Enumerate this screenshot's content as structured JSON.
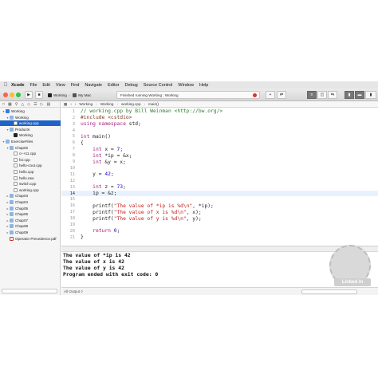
{
  "menubar": {
    "apple": "",
    "items": [
      "Xcode",
      "File",
      "Edit",
      "View",
      "Find",
      "Navigate",
      "Editor",
      "Debug",
      "Source Control",
      "Window",
      "Help"
    ]
  },
  "toolbar": {
    "scheme": "Working",
    "destination": "My Mac",
    "status": "Finished running Working : Working"
  },
  "navigator": {
    "rows": [
      {
        "label": "Working",
        "indent": 0,
        "icon": "proj",
        "tri": "▾",
        "selected": false
      },
      {
        "label": "Working",
        "indent": 1,
        "icon": "folder",
        "tri": "▾",
        "selected": false
      },
      {
        "label": "working.cpp",
        "indent": 2,
        "icon": "file",
        "tri": "",
        "selected": true
      },
      {
        "label": "Products",
        "indent": 1,
        "icon": "folder",
        "tri": "▾",
        "selected": false
      },
      {
        "label": "Working",
        "indent": 2,
        "icon": "target",
        "tri": "",
        "selected": false
      },
      {
        "label": "ExerciseFiles",
        "indent": 0,
        "icon": "folder",
        "tri": "▾",
        "selected": false
      },
      {
        "label": "Chap02",
        "indent": 1,
        "icon": "folder",
        "tri": "▾",
        "selected": false
      },
      {
        "label": "c++11.cpp",
        "indent": 2,
        "icon": "file",
        "tri": "",
        "selected": false
      },
      {
        "label": "for.cpp",
        "indent": 2,
        "icon": "file",
        "tri": "",
        "selected": false
      },
      {
        "label": "hello-cout.cpp",
        "indent": 2,
        "icon": "file",
        "tri": "",
        "selected": false
      },
      {
        "label": "hello.cpp",
        "indent": 2,
        "icon": "file",
        "tri": "",
        "selected": false
      },
      {
        "label": "hello.raw",
        "indent": 2,
        "icon": "file",
        "tri": "",
        "selected": false
      },
      {
        "label": "switch.cpp",
        "indent": 2,
        "icon": "file",
        "tri": "",
        "selected": false
      },
      {
        "label": "working.cpp",
        "indent": 2,
        "icon": "file",
        "tri": "",
        "selected": false
      },
      {
        "label": "Chap03",
        "indent": 1,
        "icon": "folder",
        "tri": "▸",
        "selected": false
      },
      {
        "label": "Chap04",
        "indent": 1,
        "icon": "folder",
        "tri": "▸",
        "selected": false
      },
      {
        "label": "Chap05",
        "indent": 1,
        "icon": "folder",
        "tri": "▸",
        "selected": false
      },
      {
        "label": "Chap06",
        "indent": 1,
        "icon": "folder",
        "tri": "▸",
        "selected": false
      },
      {
        "label": "Chap07",
        "indent": 1,
        "icon": "folder",
        "tri": "▸",
        "selected": false
      },
      {
        "label": "Chap08",
        "indent": 1,
        "icon": "folder",
        "tri": "▸",
        "selected": false
      },
      {
        "label": "Chap09",
        "indent": 1,
        "icon": "folder",
        "tri": "▸",
        "selected": false
      },
      {
        "label": "Operator Precedence.pdf",
        "indent": 1,
        "icon": "pdf",
        "tri": "",
        "selected": false
      }
    ]
  },
  "jumpbar": {
    "crumbs": [
      "Working",
      "Working",
      "working.cpp",
      "main()"
    ]
  },
  "editor": {
    "current_line": 14,
    "lines": [
      {
        "n": 1,
        "tokens": [
          [
            "c",
            "// working.cpp by Bill Weinman <http://bw.org/>"
          ]
        ]
      },
      {
        "n": 2,
        "tokens": [
          [
            "p",
            "#include <cstdio>"
          ]
        ]
      },
      {
        "n": 3,
        "tokens": [
          [
            "k",
            "using namespace "
          ],
          [
            "t",
            "std;"
          ]
        ]
      },
      {
        "n": 4,
        "tokens": []
      },
      {
        "n": 5,
        "tokens": [
          [
            "k",
            "int "
          ],
          [
            "t",
            "main()"
          ]
        ]
      },
      {
        "n": 6,
        "tokens": [
          [
            "t",
            "{"
          ]
        ]
      },
      {
        "n": 7,
        "tokens": [
          [
            "k",
            "    int "
          ],
          [
            "t",
            "x = "
          ],
          [
            "n",
            "7"
          ],
          [
            "t",
            ";"
          ]
        ]
      },
      {
        "n": 8,
        "tokens": [
          [
            "k",
            "    int "
          ],
          [
            "t",
            "*ip = &x;"
          ]
        ]
      },
      {
        "n": 9,
        "tokens": [
          [
            "k",
            "    int "
          ],
          [
            "t",
            "&y = x;"
          ]
        ]
      },
      {
        "n": 10,
        "tokens": []
      },
      {
        "n": 11,
        "tokens": [
          [
            "t",
            "    y = "
          ],
          [
            "n",
            "42"
          ],
          [
            "t",
            ";"
          ]
        ]
      },
      {
        "n": 12,
        "tokens": []
      },
      {
        "n": 13,
        "tokens": [
          [
            "k",
            "    int "
          ],
          [
            "t",
            "z = "
          ],
          [
            "n",
            "73"
          ],
          [
            "t",
            ";"
          ]
        ]
      },
      {
        "n": 14,
        "tokens": [
          [
            "t",
            "    ip = &z;"
          ]
        ]
      },
      {
        "n": 15,
        "tokens": []
      },
      {
        "n": 16,
        "tokens": [
          [
            "t",
            "    printf("
          ],
          [
            "s",
            "\"The value of *ip is %d\\n\""
          ],
          [
            "t",
            ", *ip);"
          ]
        ]
      },
      {
        "n": 17,
        "tokens": [
          [
            "t",
            "    printf("
          ],
          [
            "s",
            "\"The value of x is %d\\n\""
          ],
          [
            "t",
            ", x);"
          ]
        ]
      },
      {
        "n": 18,
        "tokens": [
          [
            "t",
            "    printf("
          ],
          [
            "s",
            "\"The value of y is %d\\n\""
          ],
          [
            "t",
            ", y);"
          ]
        ]
      },
      {
        "n": 19,
        "tokens": []
      },
      {
        "n": 20,
        "tokens": [
          [
            "k",
            "    return "
          ],
          [
            "n",
            "0"
          ],
          [
            "t",
            ";"
          ]
        ]
      },
      {
        "n": 21,
        "tokens": [
          [
            "t",
            "}"
          ]
        ]
      }
    ]
  },
  "console": {
    "lines": [
      "The value of *ip is 42",
      "The value of x is 42",
      "The value of y is 42",
      "Program ended with exit code: 0"
    ]
  },
  "bottombar": {
    "output_label": "All Output ◊"
  },
  "watermark": {
    "text": "Linked in"
  }
}
